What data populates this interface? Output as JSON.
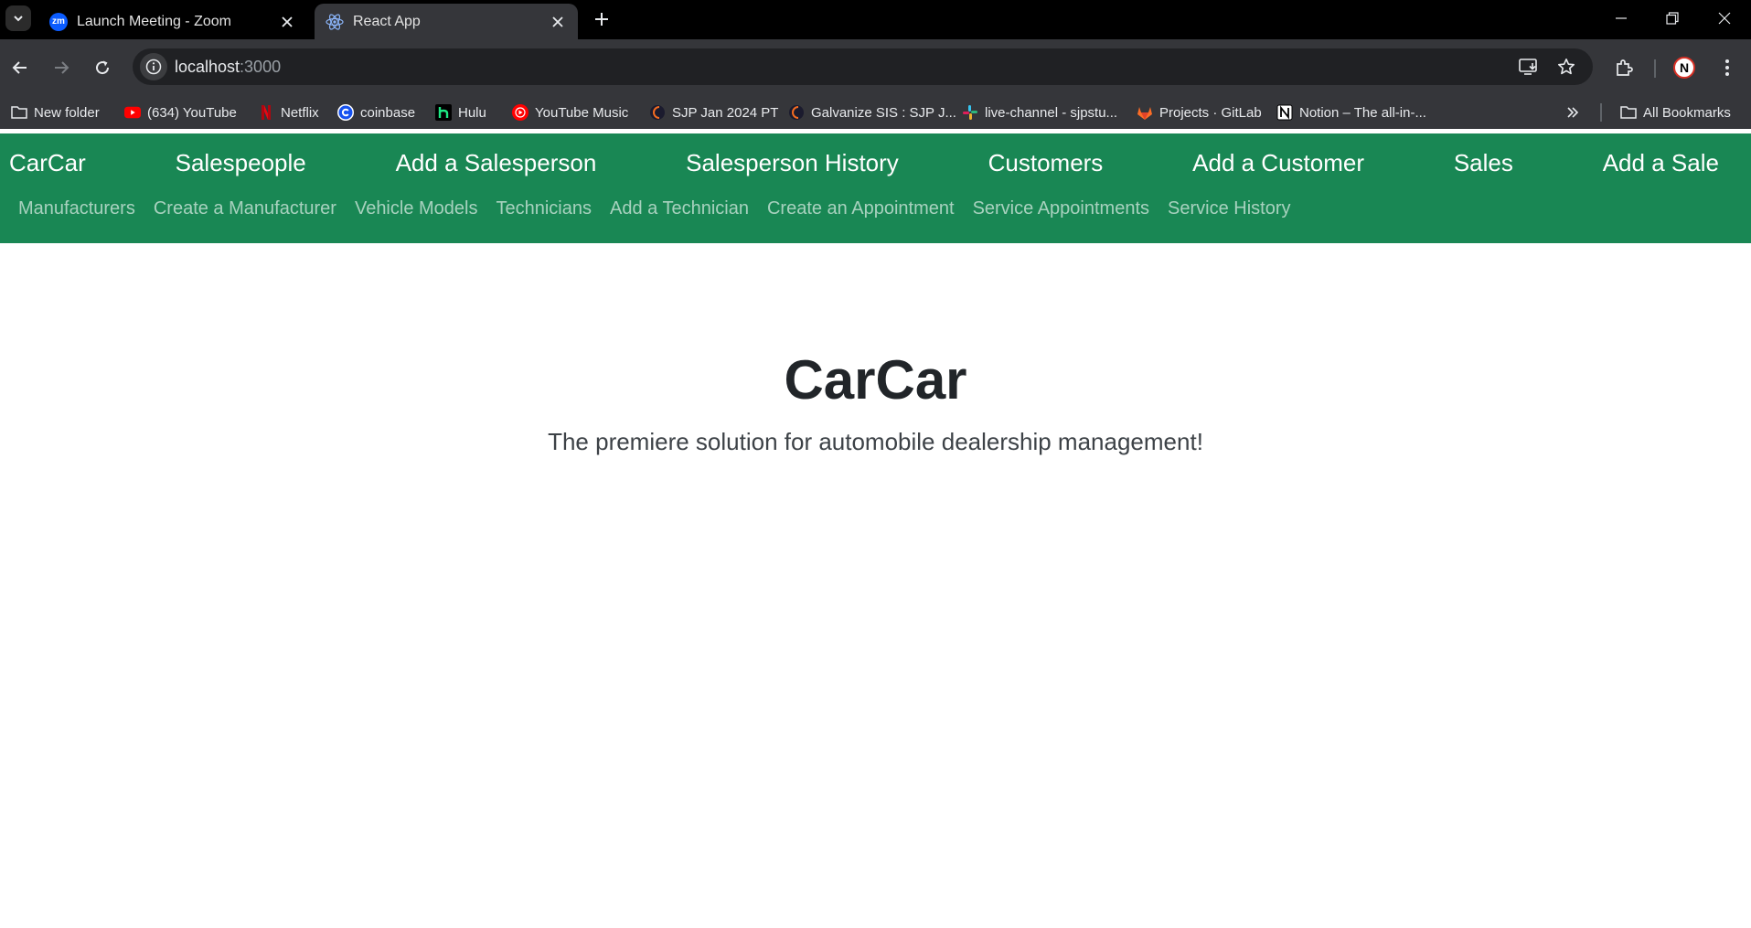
{
  "browser": {
    "tabs": [
      {
        "title": "Launch Meeting - Zoom",
        "favicon": "zoom-icon",
        "favicon_text": "zm"
      },
      {
        "title": "React App",
        "favicon": "react-icon",
        "active": true
      }
    ],
    "url_host": "localhost",
    "url_port": ":3000",
    "bookmarks": [
      {
        "label": "New folder",
        "icon": "folder-icon"
      },
      {
        "label": "(634) YouTube",
        "icon": "youtube-icon"
      },
      {
        "label": "Netflix",
        "icon": "netflix-icon"
      },
      {
        "label": "coinbase",
        "icon": "coinbase-icon"
      },
      {
        "label": "Hulu",
        "icon": "hulu-icon"
      },
      {
        "label": "YouTube Music",
        "icon": "youtube-music-icon"
      },
      {
        "label": "SJP Jan 2024 PT",
        "icon": "galvanize-icon"
      },
      {
        "label": "Galvanize SIS : SJP J...",
        "icon": "galvanize-icon"
      },
      {
        "label": "live-channel - sjpstu...",
        "icon": "slack-icon"
      },
      {
        "label": "Projects · GitLab",
        "icon": "gitlab-icon"
      },
      {
        "label": "Notion – The all-in-...",
        "icon": "notion-icon"
      }
    ],
    "all_bookmarks": "All Bookmarks",
    "profile_letter": "N",
    "colors": {
      "tabbar": "#000000",
      "toolbar": "#35363a",
      "omnibox": "#202124"
    }
  },
  "nav": {
    "brand": "CarCar",
    "main": [
      "Salespeople",
      "Add a Salesperson",
      "Salesperson History",
      "Customers",
      "Add a Customer",
      "Sales",
      "Add a Sale"
    ],
    "sub": [
      "Manufacturers",
      "Create a Manufacturer",
      "Vehicle Models",
      "Technicians",
      "Add a Technician",
      "Create an Appointment",
      "Service Appointments",
      "Service History"
    ],
    "color": "#198754"
  },
  "hero": {
    "title": "CarCar",
    "subtitle": "The premiere solution for automobile dealership management!"
  }
}
